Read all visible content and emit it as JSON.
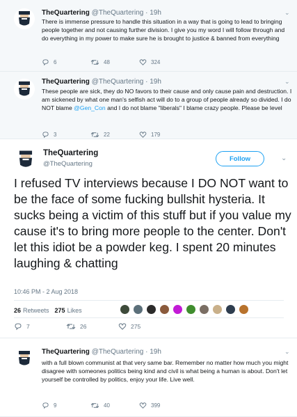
{
  "account": {
    "name": "TheQuartering",
    "handle": "@TheQuartering"
  },
  "tweets_above": [
    {
      "time": "· 19h",
      "text": "There is immense pressure to handle this situation in a way that is going to lead to bringing people together and not causing further division. I give you my word I will follow through and do everything in my power to make sure he is brought to justice & banned from everything",
      "replies": "6",
      "retweets": "48",
      "likes": "324"
    },
    {
      "time": "· 19h",
      "text_before": "These people are sick, they do NO favors to their cause and only cause pain and destruction. I am sickened by what one man's selfish act will do to a group of people already so divided.  I do NOT blame ",
      "mention": "@Gen_Con",
      "text_after": " and I do not blame \"liberals\" I blame crazy people.  Please be level",
      "replies": "3",
      "retweets": "22",
      "likes": "179"
    }
  ],
  "main_tweet": {
    "follow_label": "Follow",
    "text": "I refused TV interviews because I DO NOT want to be the face of some fucking bullshit hysteria. It sucks being a victim of this stuff but if you value my cause it's to bring more people to the center. Don't let this idiot be a powder keg.  I spent 20 minutes laughing & chatting",
    "timestamp": "10:46 PM - 2 Aug 2018",
    "retweet_count": "26",
    "retweet_label": "Retweets",
    "like_count": "275",
    "like_label": "Likes",
    "liker_colors": [
      "#3d4a3a",
      "#5b6f7a",
      "#2b2b2b",
      "#8a5a3c",
      "#c21bd6",
      "#3f8d2e",
      "#7a6e64",
      "#c9b08a",
      "#2e3d4f",
      "#b8722c"
    ],
    "replies": "7",
    "retweets": "26",
    "likes": "275"
  },
  "tweet_below": {
    "time": "· 19h",
    "text": "with a full blown communist at that very same bar.  Remember no matter how much you might disagree with someones politics being kind and civil is what being a human is about. Don't let yourself be controlled by politics, enjoy your life.  Live well.",
    "replies": "9",
    "retweets": "40",
    "likes": "399"
  },
  "colors": {
    "accent": "#1da1f2",
    "muted": "#657786",
    "thread_bg": "#f5f8fa",
    "retweet_green": "#17bf63"
  }
}
